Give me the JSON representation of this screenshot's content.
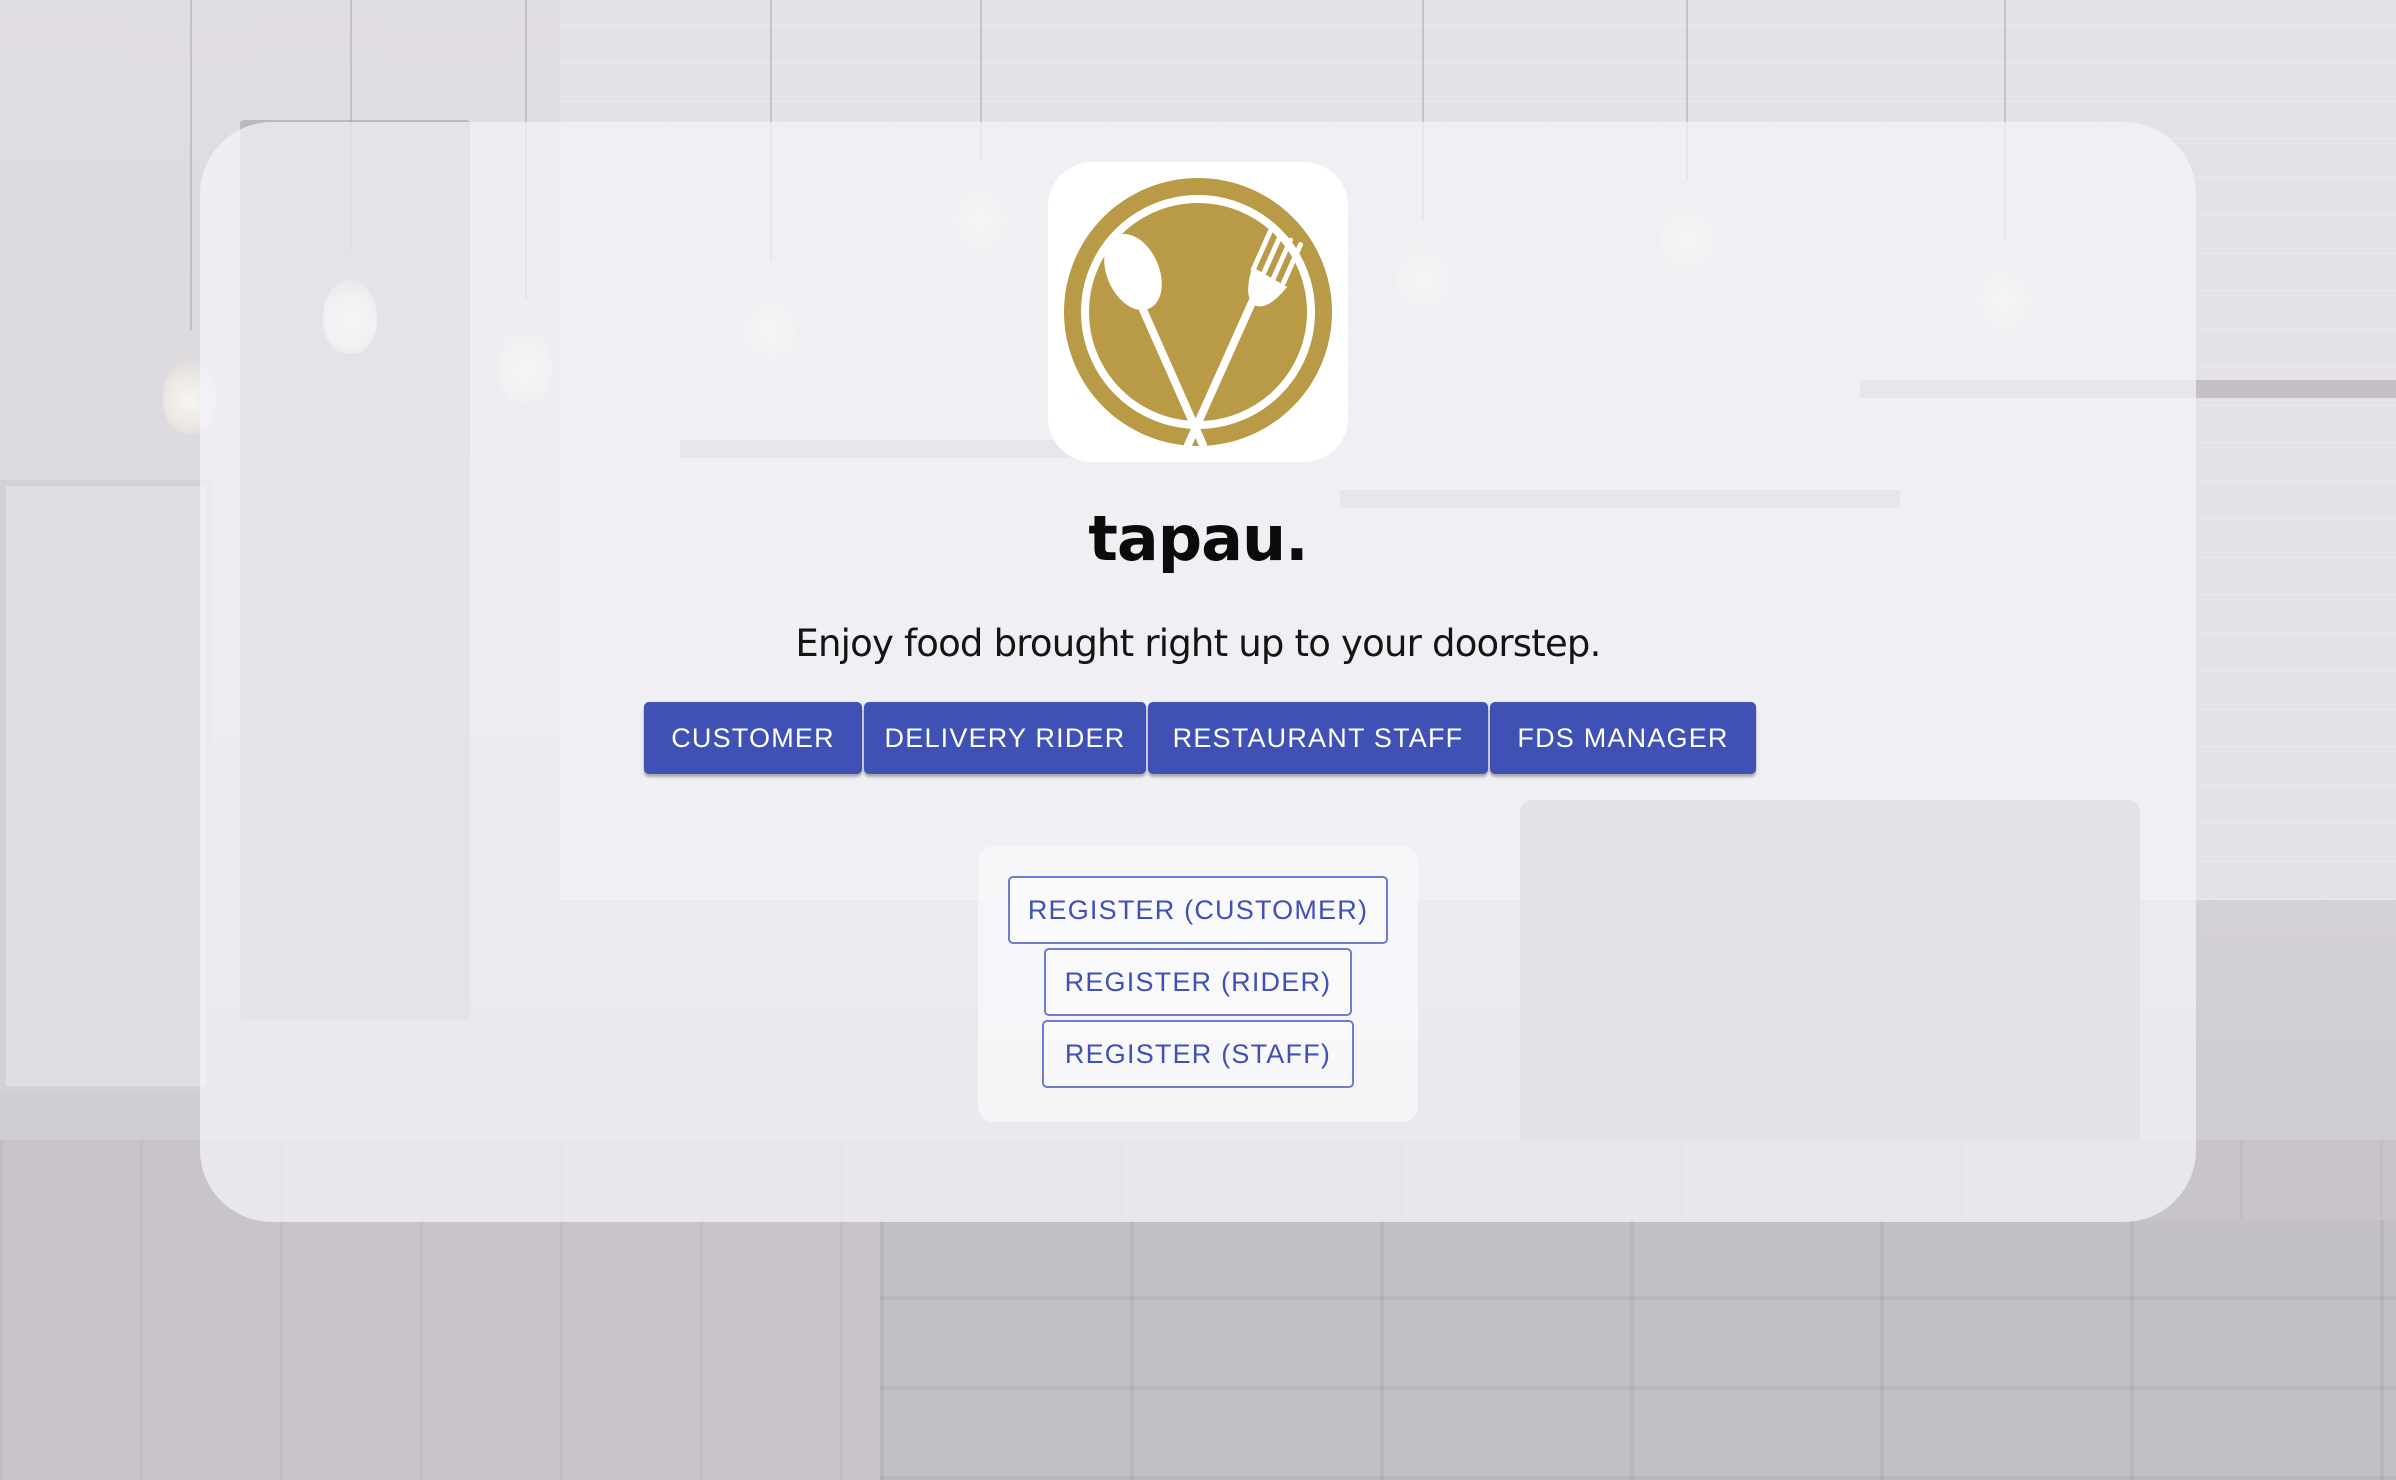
{
  "brand": {
    "name": "tapau.",
    "tagline": "Enjoy food brought right up to your doorstep.",
    "logo_icon": "spoon-fork-plate-icon",
    "logo_color": "#b99a47"
  },
  "roles": [
    {
      "label": "CUSTOMER"
    },
    {
      "label": "DELIVERY RIDER"
    },
    {
      "label": "RESTAURANT STAFF"
    },
    {
      "label": "FDS MANAGER"
    }
  ],
  "register": [
    {
      "label": "REGISTER (CUSTOMER)"
    },
    {
      "label": "REGISTER (RIDER)"
    },
    {
      "label": "REGISTER (STAFF)"
    }
  ],
  "colors": {
    "primary": "#3f51b5",
    "outline": "#6f7ccf",
    "card": "rgba(244,244,248,0.72)"
  },
  "background": {
    "icon": "cafe-background-image"
  }
}
